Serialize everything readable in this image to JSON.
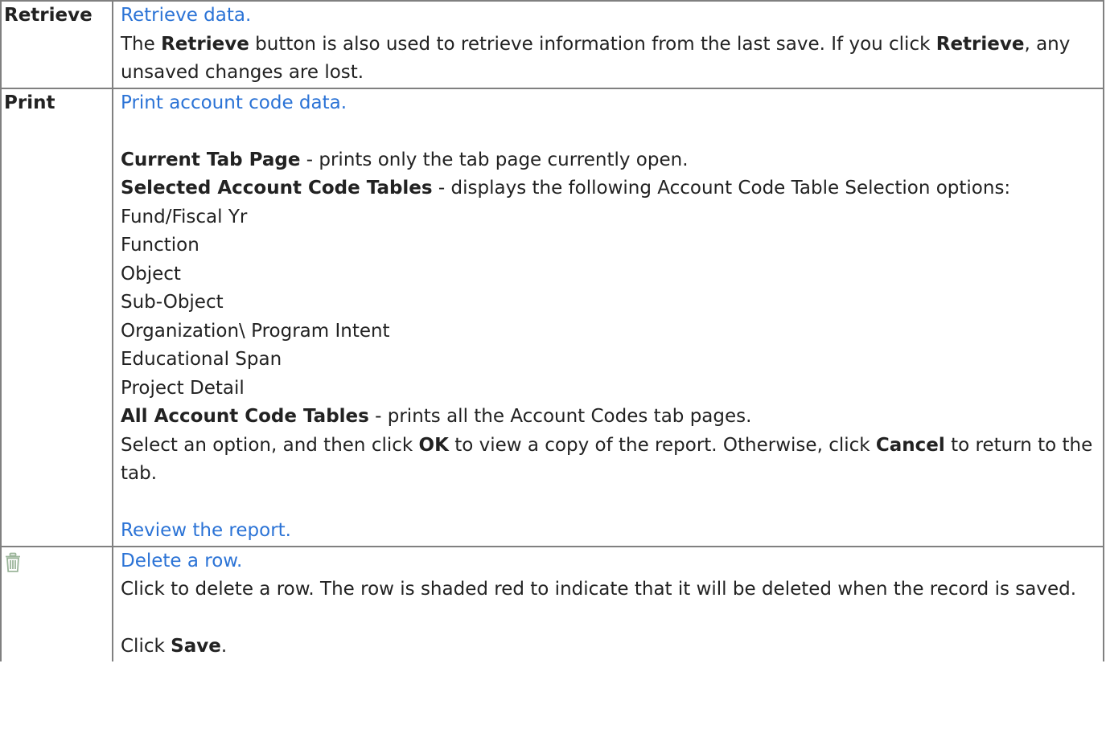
{
  "rows": {
    "retrieve": {
      "label": "Retrieve",
      "link": "Retrieve data.",
      "d1": "The ",
      "d1b": "Retrieve",
      "d1c": " button is also used to retrieve information from the last save. If you click ",
      "d1d": "Retrieve",
      "d1e": ", any unsaved changes are lost."
    },
    "print": {
      "label": "Print",
      "link": "Print account code data.",
      "current_tab_bold": "Current Tab Page",
      "current_tab_text": " - prints only the tab page currently open.",
      "selected_bold": "Selected Account Code Tables",
      "selected_text": " - displays the following Account Code Table Selection options:",
      "options": [
        "Fund/Fiscal Yr",
        "Function",
        "Object",
        "Sub-Object",
        "Organization\\ Program Intent",
        "Educational Span",
        "Project Detail"
      ],
      "all_bold": "All Account Code Tables",
      "all_text": " - prints all the Account Codes tab pages.",
      "select_a": "Select an option, and then click ",
      "select_ok": "OK",
      "select_b": " to view a copy of the report. Otherwise, click ",
      "select_cancel": "Cancel",
      "select_c": " to return to the tab.",
      "review_link": "Review the report."
    },
    "delete": {
      "icon": "trash-icon",
      "icon_color": "#9bb59a",
      "link": "Delete a row.",
      "text": "Click to delete a row. The row is shaded red to indicate that it will be deleted when the record is saved.",
      "click_a": "Click ",
      "click_save": "Save",
      "click_b": "."
    }
  },
  "colors": {
    "link": "#2b73d6",
    "border": "#808080",
    "text": "#222222"
  }
}
